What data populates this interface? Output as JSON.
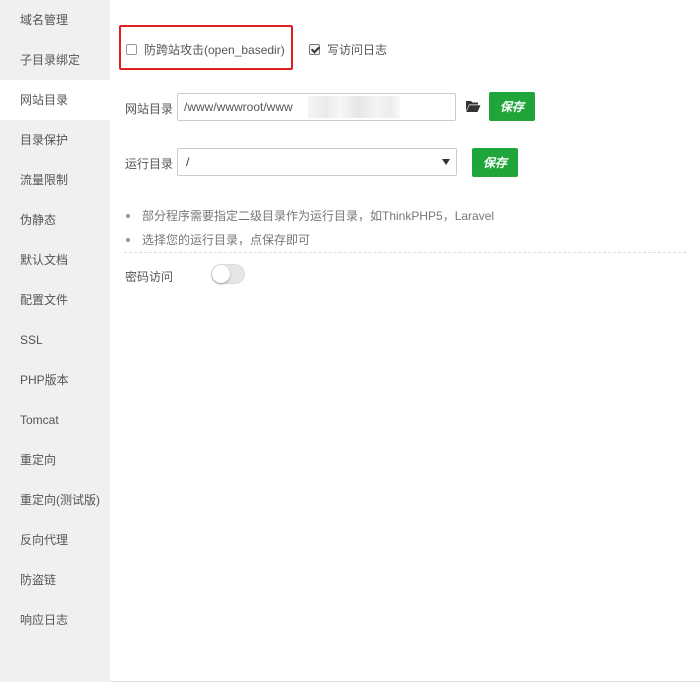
{
  "sidebar": {
    "items": [
      {
        "label": "域名管理"
      },
      {
        "label": "子目录绑定"
      },
      {
        "label": "网站目录"
      },
      {
        "label": "目录保护"
      },
      {
        "label": "流量限制"
      },
      {
        "label": "伪静态"
      },
      {
        "label": "默认文档"
      },
      {
        "label": "配置文件"
      },
      {
        "label": "SSL"
      },
      {
        "label": "PHP版本"
      },
      {
        "label": "Tomcat"
      },
      {
        "label": "重定向"
      },
      {
        "label": "重定向(测试版)"
      },
      {
        "label": "反向代理"
      },
      {
        "label": "防盗链"
      },
      {
        "label": "响应日志"
      }
    ],
    "active_index": 2
  },
  "options": {
    "anti_xss_label": "防跨站攻击(open_basedir)",
    "anti_xss_checked": false,
    "write_log_label": "写访问日志",
    "write_log_checked": true
  },
  "site_dir": {
    "label": "网站目录",
    "value": "/www/wwwroot/www",
    "save_label": "保存",
    "folder_icon": "folder-open-icon"
  },
  "run_dir": {
    "label": "运行目录",
    "selected": "/",
    "save_label": "保存"
  },
  "tips": [
    "部分程序需要指定二级目录作为运行目录，如ThinkPHP5，Laravel",
    "选择您的运行目录，点保存即可"
  ],
  "password_access": {
    "label": "密码访问",
    "enabled": false
  },
  "colors": {
    "accent": "#20a53a",
    "highlight": "#e02020",
    "sidebar_bg": "#f0f0f0"
  }
}
